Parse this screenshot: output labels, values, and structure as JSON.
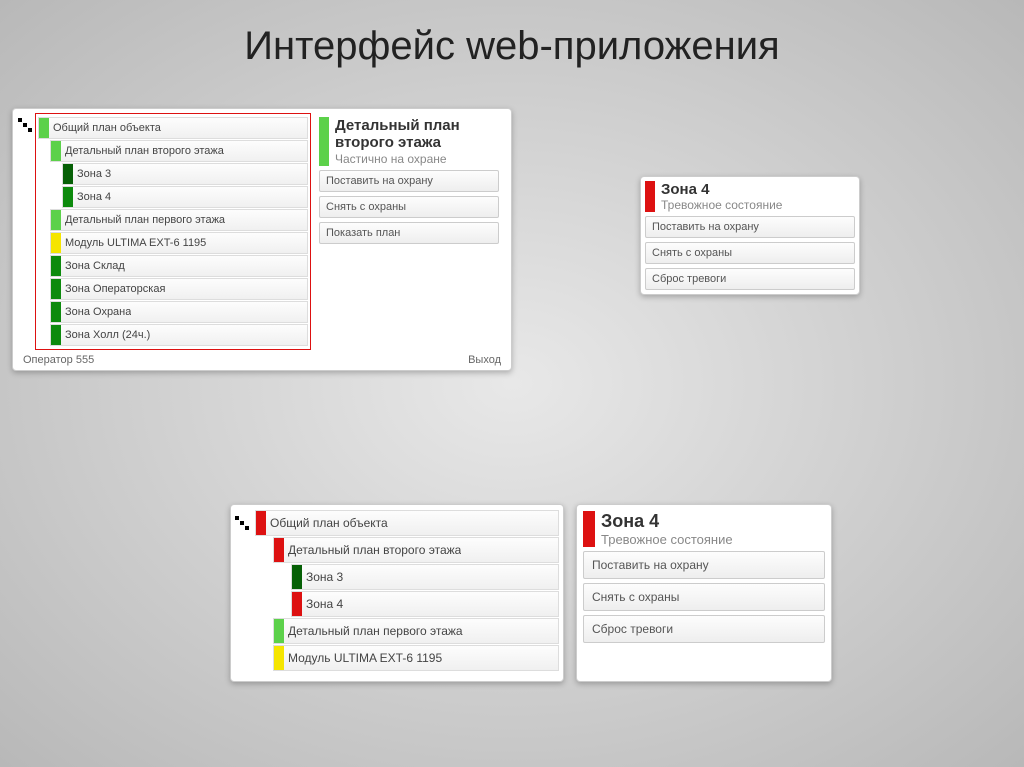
{
  "slide": {
    "title": "Интерфейс web-приложения"
  },
  "panel1": {
    "tree": [
      {
        "label": "Общий план объекта",
        "indent": 0,
        "color": "lightgreen"
      },
      {
        "label": "Детальный план второго этажа",
        "indent": 1,
        "color": "lightgreen"
      },
      {
        "label": "Зона 3",
        "indent": 2,
        "color": "darkgreen"
      },
      {
        "label": "Зона 4",
        "indent": 2,
        "color": "green"
      },
      {
        "label": "Детальный план первого этажа",
        "indent": 1,
        "color": "lightgreen"
      },
      {
        "label": "Модуль ULTIMA EXT-6 1195",
        "indent": 1,
        "color": "yellow"
      },
      {
        "label": "Зона Склад",
        "indent": 1,
        "color": "green"
      },
      {
        "label": "Зона Операторская",
        "indent": 1,
        "color": "green"
      },
      {
        "label": "Зона Охрана",
        "indent": 1,
        "color": "green"
      },
      {
        "label": "Зона Холл (24ч.)",
        "indent": 1,
        "color": "green"
      }
    ],
    "detail": {
      "title_line1": "Детальный план",
      "title_line2": "второго этажа",
      "status": "Частично на охране",
      "color": "lightgreen",
      "actions": [
        "Поставить на охрану",
        "Снять с охраны",
        "Показать план"
      ]
    },
    "footer": {
      "operator": "Оператор 555",
      "exit": "Выход"
    }
  },
  "panel2": {
    "title": "Зона 4",
    "status": "Тревожное состояние",
    "color": "red",
    "actions": [
      "Поставить на охрану",
      "Снять с охраны",
      "Сброс тревоги"
    ]
  },
  "panel3": {
    "tree": [
      {
        "label": "Общий план объекта",
        "indent": 0,
        "color": "red"
      },
      {
        "label": "Детальный план второго этажа",
        "indent": 1,
        "color": "red"
      },
      {
        "label": "Зона 3",
        "indent": 2,
        "color": "darkgreen"
      },
      {
        "label": "Зона 4",
        "indent": 2,
        "color": "red"
      },
      {
        "label": "Детальный план первого этажа",
        "indent": 1,
        "color": "lightgreen"
      },
      {
        "label": "Модуль ULTIMA EXT-6 1195",
        "indent": 1,
        "color": "yellow"
      }
    ]
  },
  "panel4": {
    "title": "Зона 4",
    "status": "Тревожное состояние",
    "color": "red",
    "actions": [
      "Поставить на охрану",
      "Снять с охраны",
      "Сброс тревоги"
    ]
  }
}
